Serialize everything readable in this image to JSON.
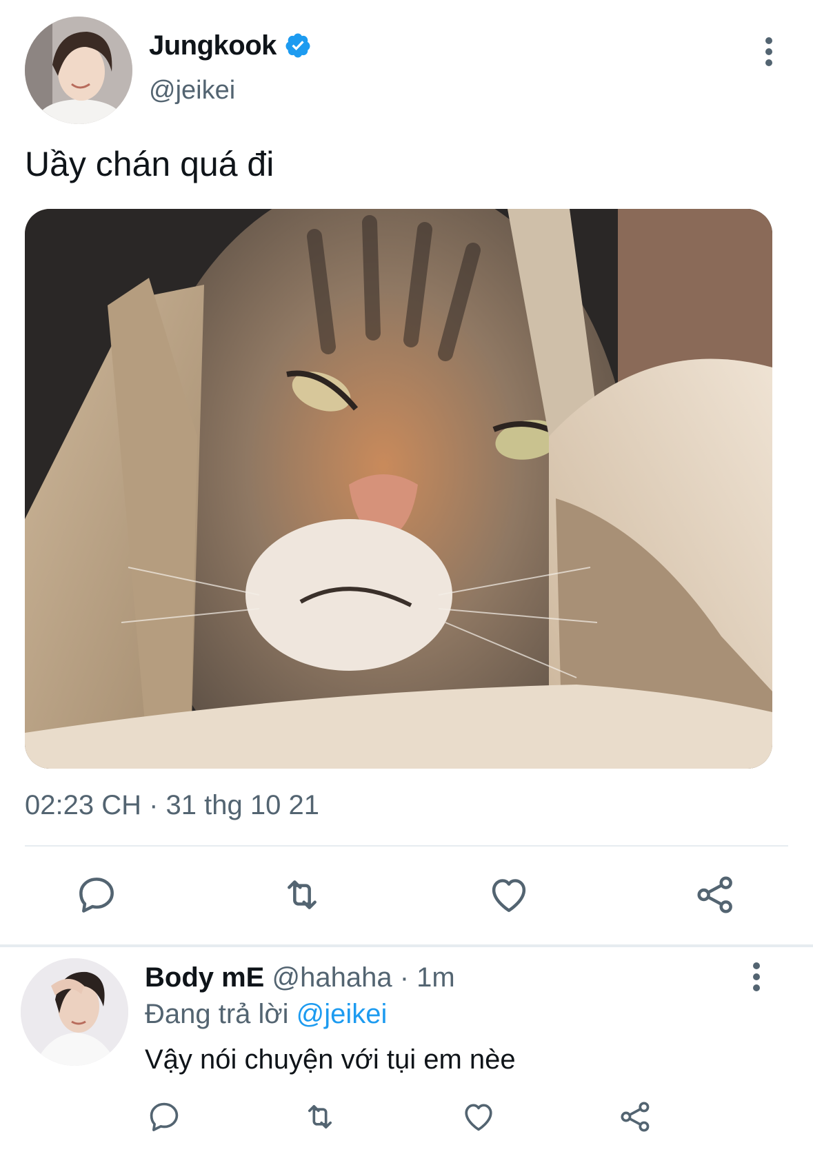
{
  "tweet": {
    "author_name": "Jungkook",
    "author_handle": "@jeikei",
    "verified_icon": "verified-badge-icon",
    "text": "Uầy chán quá đi",
    "media": "photo of a grumpy tabby cat peeking from a paper bag",
    "timestamp": "02:23 CH · 31 thg 10 21",
    "actions": [
      "reply-icon",
      "retweet-icon",
      "like-icon",
      "share-icon"
    ]
  },
  "reply": {
    "author_name": "Body mE",
    "author_handle": "@hahaha",
    "separator": "·",
    "time": "1m",
    "replying_prefix": "Đang trả lời",
    "replying_to": "@jeikei",
    "text": "Vậy nói chuyện với tụi em nèe",
    "actions": [
      "reply-icon",
      "retweet-icon",
      "like-icon",
      "share-icon"
    ]
  },
  "colors": {
    "accent": "#1d9bf0",
    "secondary_text": "#536471",
    "primary_text": "#0f1419",
    "divider": "#e6ecf0",
    "icon": "#536471"
  }
}
